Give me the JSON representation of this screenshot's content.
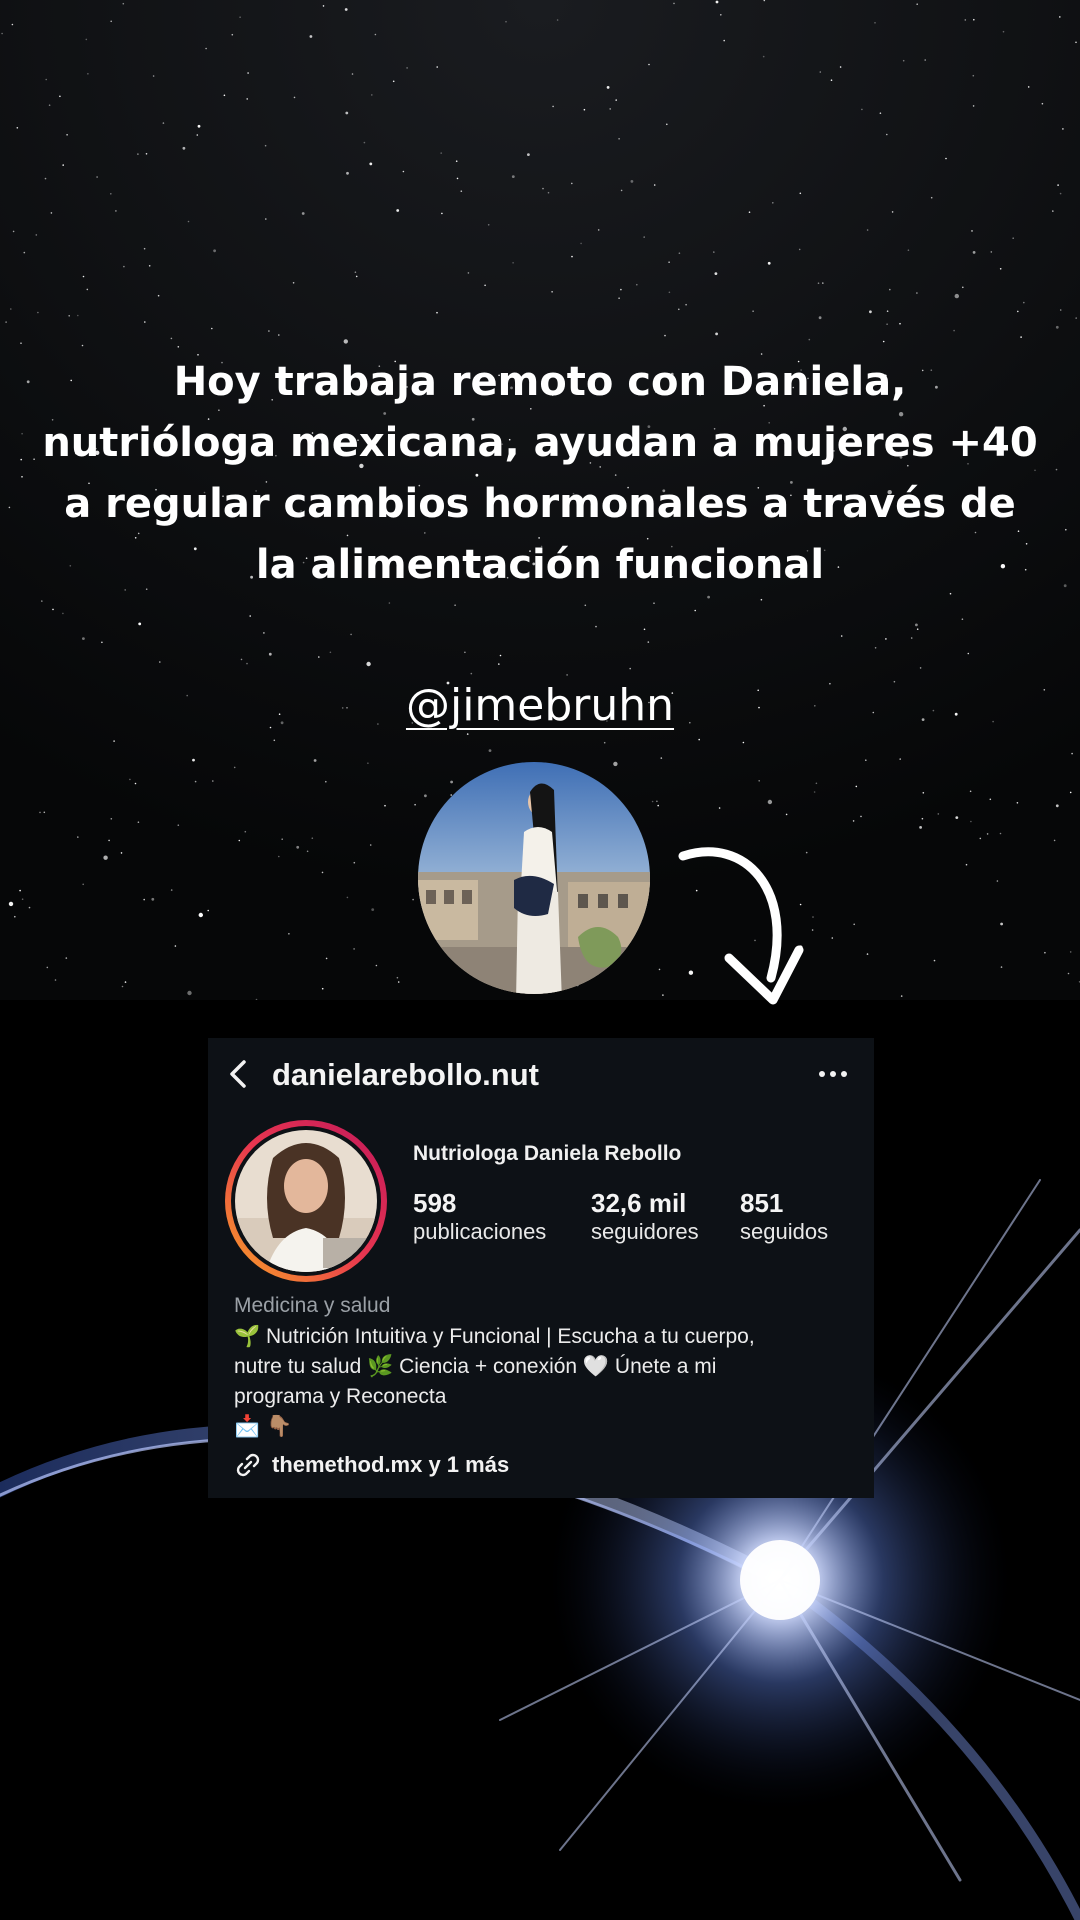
{
  "headline": {
    "line1": "Hoy trabaja remoto con Daniela,",
    "line2": "nutrióloga mexicana, ayudan a mujeres +40",
    "line3": "a regular cambios hormonales a través de",
    "line4": "la alimentación funcional"
  },
  "handle": "@jimebruhn",
  "profile": {
    "username": "danielarebollo.nut",
    "full_name": "Nutriologa Daniela Rebollo",
    "stats": [
      {
        "value": "598",
        "label": "publicaciones"
      },
      {
        "value": "32,6 mil",
        "label": "seguidores"
      },
      {
        "value": "851",
        "label": "seguidos"
      }
    ],
    "category": "Medicina y salud",
    "bio": {
      "line1": "🌱 Nutrición Intuitiva y Funcional | Escucha a tu cuerpo,",
      "line2": "nutre tu salud 🌿 Ciencia + conexión 🤍 Únete a mi",
      "line3": "programa y Reconecta",
      "line4": "📩 👇🏽"
    },
    "link": "themethod.mx y 1 más"
  },
  "icons": {
    "back": "chevron-left-icon",
    "more": "more-options-icon",
    "link": "link-icon",
    "arrow": "curved-arrow-icon"
  },
  "colors": {
    "card_bg": "#0d1116",
    "story_ring_start": "#f9a825",
    "story_ring_end": "#c2185b",
    "flare": "#6f8fe0"
  }
}
